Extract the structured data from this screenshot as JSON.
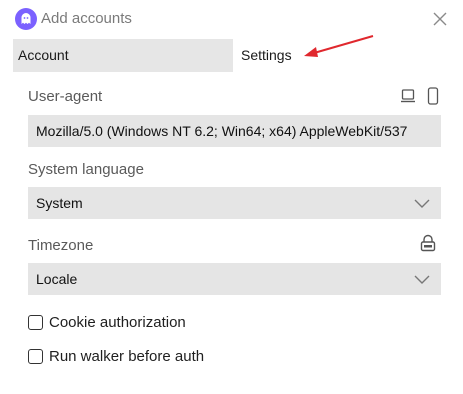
{
  "window": {
    "title": "Add accounts",
    "app_icon": "ghost-icon",
    "accent_color": "#7b61ff"
  },
  "tabs": [
    {
      "label": "Account",
      "active": false
    },
    {
      "label": "Settings",
      "active": true
    }
  ],
  "annotation": {
    "arrow_color": "#e0282e"
  },
  "settings": {
    "user_agent": {
      "label": "User-agent",
      "value": "Mozilla/5.0 (Windows NT 6.2; Win64; x64) AppleWebKit/537",
      "icons": [
        "laptop-icon",
        "smartphone-icon"
      ]
    },
    "system_language": {
      "label": "System language",
      "value": "System"
    },
    "timezone": {
      "label": "Timezone",
      "value": "Locale",
      "icon": "lock-icon"
    },
    "checkboxes": [
      {
        "label": "Cookie authorization",
        "checked": false
      },
      {
        "label": "Run walker before auth",
        "checked": false
      }
    ]
  }
}
